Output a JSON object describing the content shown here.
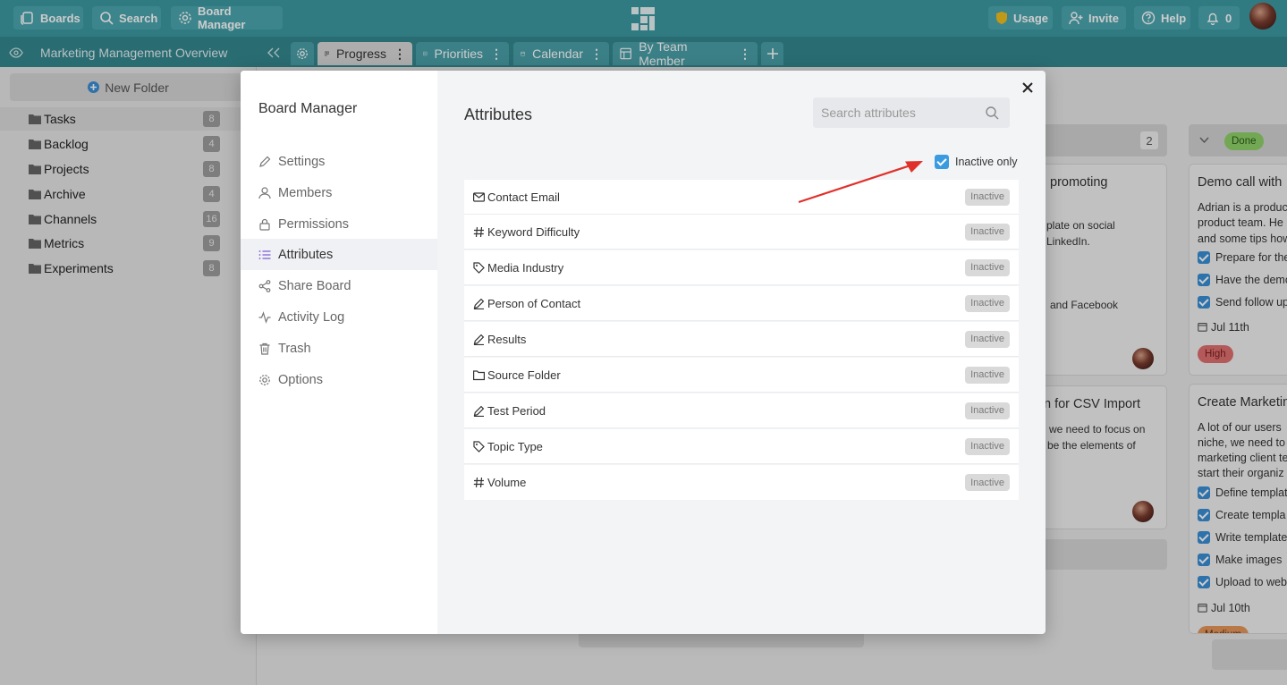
{
  "topbar": {
    "boards": "Boards",
    "search": "Search",
    "board_manager": "Board Manager",
    "usage": "Usage",
    "invite": "Invite",
    "help": "Help",
    "notifications": "0"
  },
  "tabbar": {
    "board_title": "Marketing Management Overview",
    "tabs": [
      "Progress",
      "Priorities",
      "Calendar",
      "By Team Member"
    ]
  },
  "sidebar": {
    "new_folder": "New Folder",
    "folders": [
      {
        "label": "Tasks",
        "count": "8"
      },
      {
        "label": "Backlog",
        "count": "4"
      },
      {
        "label": "Projects",
        "count": "8"
      },
      {
        "label": "Archive",
        "count": "4"
      },
      {
        "label": "Channels",
        "count": "16"
      },
      {
        "label": "Metrics",
        "count": "9"
      },
      {
        "label": "Experiments",
        "count": "8"
      }
    ]
  },
  "board": {
    "col2_count": "2",
    "col3_badge": "Done",
    "card_a": {
      "title": "promoting",
      "line1": "plate on social",
      "line2": "LinkedIn.",
      "line3": "and Facebook"
    },
    "card_b": {
      "title": "n for CSV Import",
      "line1": "we need to focus on",
      "line2": "be the elements of"
    },
    "card_c": {
      "title": "Demo call with",
      "lines": [
        "Adrian is a produc",
        "product team. He",
        "and some tips how"
      ],
      "checks": [
        "Prepare for the",
        "Have the demo",
        "Send follow up"
      ],
      "date": "Jul 11th",
      "priority": "High"
    },
    "card_d": {
      "title": "Create Marketin",
      "lines": [
        "A lot of our users",
        "niche, we need to",
        "marketing client te",
        "start their organiz"
      ],
      "checks": [
        "Define templat",
        "Create templa",
        "Write template",
        "Make images",
        "Upload to web"
      ],
      "date": "Jul 10th",
      "priority": "Medium"
    }
  },
  "modal": {
    "nav_title": "Board Manager",
    "nav_items": [
      "Settings",
      "Members",
      "Permissions",
      "Attributes",
      "Share Board",
      "Activity Log",
      "Trash",
      "Options"
    ],
    "title": "Attributes",
    "search_placeholder": "Search attributes",
    "inactive_only_label": "Inactive only",
    "attributes": [
      {
        "name": "Contact Email",
        "icon": "mail-icon",
        "status": "Inactive"
      },
      {
        "name": "Keyword Difficulty",
        "icon": "hash-icon",
        "status": "Inactive"
      },
      {
        "name": "Media Industry",
        "icon": "tag-icon",
        "status": "Inactive"
      },
      {
        "name": "Person of Contact",
        "icon": "pencil-icon",
        "status": "Inactive"
      },
      {
        "name": "Results",
        "icon": "pencil-icon",
        "status": "Inactive"
      },
      {
        "name": "Source Folder",
        "icon": "folder-icon",
        "status": "Inactive"
      },
      {
        "name": "Test Period",
        "icon": "pencil-icon",
        "status": "Inactive"
      },
      {
        "name": "Topic Type",
        "icon": "tag-icon",
        "status": "Inactive"
      },
      {
        "name": "Volume",
        "icon": "hash-icon",
        "status": "Inactive"
      }
    ]
  },
  "colors": {
    "topbar": "#3d9aa3",
    "tabbar": "#34878f",
    "accent_blue": "#3a9be0",
    "annotation_arrow": "#e0302a",
    "badge_done": "#8fd36a",
    "badge_high": "#e07070",
    "badge_medium": "#e6975a"
  }
}
